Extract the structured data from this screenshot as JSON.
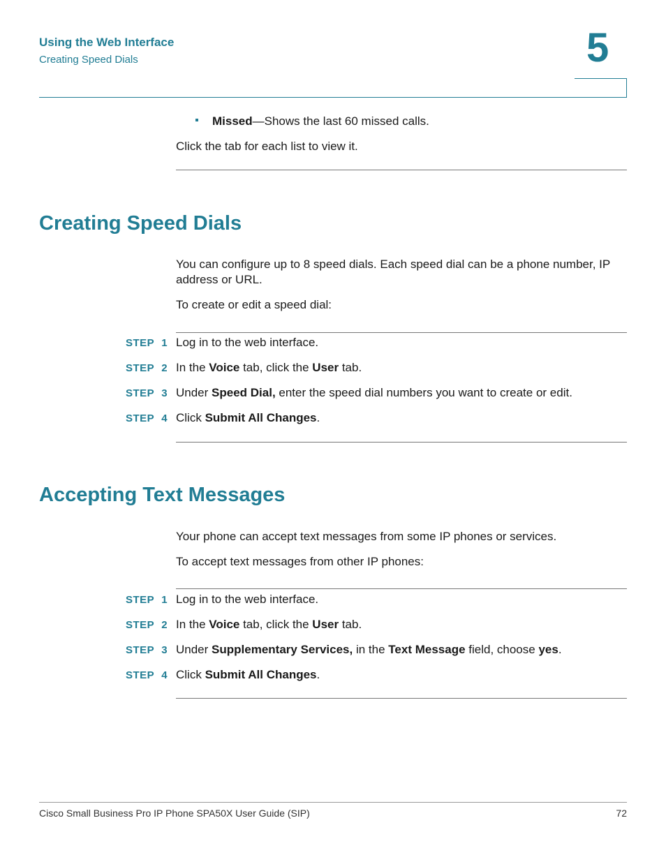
{
  "header": {
    "chapter_title": "Using the Web Interface",
    "section_title": "Creating Speed Dials",
    "chapter_number": "5"
  },
  "intro": {
    "bullet": {
      "term": "Missed",
      "text": "—Shows the last 60 missed calls."
    },
    "paragraph": "Click the tab for each list to view it."
  },
  "sections": [
    {
      "title": "Creating Speed Dials",
      "paragraphs": [
        "You can configure up to 8 speed dials. Each speed dial can be a phone number, IP",
        "address or URL.",
        "To create or edit a speed dial:"
      ],
      "steps": [
        {
          "label": "STEP",
          "num": "1",
          "parts": [
            {
              "t": "Log in to the web interface."
            }
          ]
        },
        {
          "label": "STEP",
          "num": "2",
          "parts": [
            {
              "t": "In the "
            },
            {
              "b": "Voice"
            },
            {
              "t": " tab, click the "
            },
            {
              "b": "User"
            },
            {
              "t": " tab."
            }
          ]
        },
        {
          "label": "STEP",
          "num": "3",
          "parts": [
            {
              "t": "Under "
            },
            {
              "b": "Speed Dial,"
            },
            {
              "t": " enter the speed dial numbers you want to create or edit."
            }
          ]
        },
        {
          "label": "STEP",
          "num": "4",
          "parts": [
            {
              "t": "Click "
            },
            {
              "b": "Submit All Changes"
            },
            {
              "t": "."
            }
          ]
        }
      ]
    },
    {
      "title": "Accepting Text Messages",
      "paragraphs": [
        "Your phone can accept text messages from some IP phones or services.",
        "To accept text messages from other IP phones:"
      ],
      "steps": [
        {
          "label": "STEP",
          "num": "1",
          "parts": [
            {
              "t": "Log in to the web interface."
            }
          ]
        },
        {
          "label": "STEP",
          "num": "2",
          "parts": [
            {
              "t": "In the "
            },
            {
              "b": "Voice"
            },
            {
              "t": " tab, click the "
            },
            {
              "b": "User"
            },
            {
              "t": " tab."
            }
          ]
        },
        {
          "label": "STEP",
          "num": "3",
          "parts": [
            {
              "t": "Under "
            },
            {
              "b": "Supplementary Services,"
            },
            {
              "t": " in the "
            },
            {
              "b": "Text Message"
            },
            {
              "t": " field, choose "
            },
            {
              "b": "yes"
            },
            {
              "t": "."
            }
          ]
        },
        {
          "label": "STEP",
          "num": "4",
          "parts": [
            {
              "t": "Click "
            },
            {
              "b": "Submit All Changes"
            },
            {
              "t": "."
            }
          ]
        }
      ]
    }
  ],
  "footer": {
    "title": "Cisco Small Business Pro IP Phone SPA50X User Guide (SIP)",
    "page": "72"
  }
}
